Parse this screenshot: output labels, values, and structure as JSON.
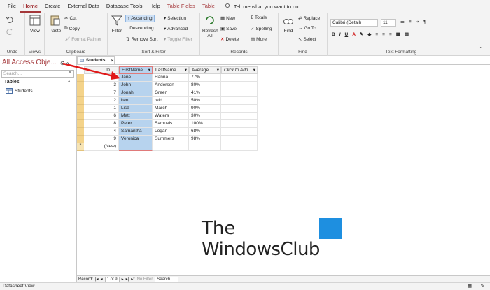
{
  "menubar": {
    "tabs": [
      "File",
      "Home",
      "Create",
      "External Data",
      "Database Tools",
      "Help",
      "Table Fields",
      "Table"
    ],
    "active": "Home",
    "tell_me": "Tell me what you want to do"
  },
  "ribbon": {
    "undo_label": "Undo",
    "views": {
      "view": "View",
      "group": "Views"
    },
    "clipboard": {
      "paste": "Paste",
      "cut": "Cut",
      "copy": "Copy",
      "format_painter": "Format Painter",
      "group": "Clipboard"
    },
    "sort": {
      "filter": "Filter",
      "ascending": "Ascending",
      "descending": "Descending",
      "remove_sort": "Remove Sort",
      "selection": "Selection",
      "advanced": "Advanced",
      "toggle_filter": "Toggle Filter",
      "group": "Sort & Filter"
    },
    "records": {
      "refresh": "Refresh",
      "all": "All",
      "new": "New",
      "save": "Save",
      "delete": "Delete",
      "totals": "Totals",
      "spelling": "Spelling",
      "more": "More",
      "group": "Records"
    },
    "find": {
      "find": "Find",
      "replace": "Replace",
      "goto": "Go To",
      "select": "Select",
      "group": "Find"
    },
    "text": {
      "font": "Calibri (Detail)",
      "size": "11",
      "group": "Text Formatting"
    }
  },
  "nav": {
    "title": "All Access Obje...",
    "search_placeholder": "Search...",
    "section": "Tables",
    "item": "Students"
  },
  "doc_tab": "Students",
  "table": {
    "columns": [
      "ID",
      "FirstName",
      "LastName",
      "Average",
      "Click to Add"
    ],
    "rows": [
      {
        "id": "5",
        "first": "Jane",
        "last": "Hanna",
        "avg": "77%"
      },
      {
        "id": "3",
        "first": "John",
        "last": "Anderson",
        "avg": "80%"
      },
      {
        "id": "7",
        "first": "Jonah",
        "last": "Green",
        "avg": "41%"
      },
      {
        "id": "2",
        "first": "ken",
        "last": "reid",
        "avg": "50%"
      },
      {
        "id": "1",
        "first": "Lisa",
        "last": "March",
        "avg": "90%"
      },
      {
        "id": "6",
        "first": "Matt",
        "last": "Waters",
        "avg": "30%"
      },
      {
        "id": "8",
        "first": "Peter",
        "last": "Samuels",
        "avg": "100%"
      },
      {
        "id": "4",
        "first": "Samantha",
        "last": "Logan",
        "avg": "68%"
      },
      {
        "id": "9",
        "first": "Veronica",
        "last": "Summers",
        "avg": "98%"
      }
    ],
    "new_row": "(New)"
  },
  "record_nav": {
    "label": "Record:",
    "position": "1 of 9",
    "no_filter": "No Filter",
    "search": "Search"
  },
  "status": "Datasheet View",
  "watermark": {
    "line1": "The",
    "line2": "WindowsClub"
  },
  "colors": {
    "accent": "#a4373a",
    "selection": "#b7d3ee",
    "row_selector": "#f4d38a"
  }
}
